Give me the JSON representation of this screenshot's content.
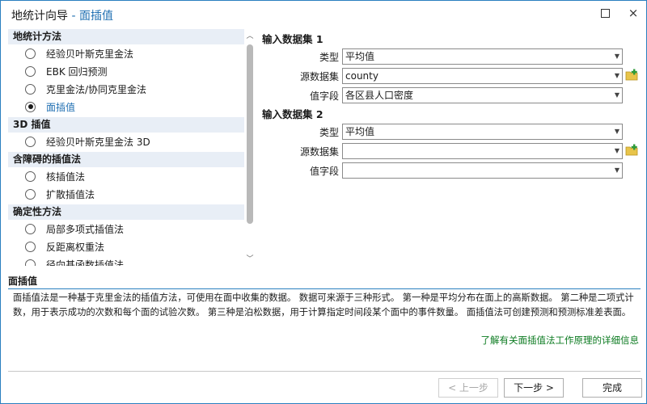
{
  "window": {
    "title_main": "地统计向导",
    "title_sep": " - ",
    "title_sub": "面插值",
    "maximize_icon": "maximize-icon",
    "close_icon": "×"
  },
  "methods": {
    "groups": [
      {
        "header": "地统计方法",
        "options": [
          {
            "label": "经验贝叶斯克里金法",
            "selected": false
          },
          {
            "label": "EBK 回归预测",
            "selected": false
          },
          {
            "label": "克里金法/协同克里金法",
            "selected": false
          },
          {
            "label": "面插值",
            "selected": true
          }
        ]
      },
      {
        "header": "3D 插值",
        "options": [
          {
            "label": "经验贝叶斯克里金法 3D",
            "selected": false
          }
        ]
      },
      {
        "header": "含障碍的插值法",
        "options": [
          {
            "label": "核插值法",
            "selected": false
          },
          {
            "label": "扩散插值法",
            "selected": false
          }
        ]
      },
      {
        "header": "确定性方法",
        "options": [
          {
            "label": "局部多项式插值法",
            "selected": false
          },
          {
            "label": "反距离权重法",
            "selected": false
          },
          {
            "label": "径向基函数插值法",
            "selected": false
          }
        ]
      }
    ]
  },
  "dataset1": {
    "title": "输入数据集 1",
    "type_label": "类型",
    "type_value": "平均值",
    "source_label": "源数据集",
    "source_value": "county",
    "field_label": "值字段",
    "field_value": "各区县人口密度"
  },
  "dataset2": {
    "title": "输入数据集 2",
    "type_label": "类型",
    "type_value": "平均值",
    "source_label": "源数据集",
    "source_value": "",
    "field_label": "值字段",
    "field_value": ""
  },
  "description": {
    "title": "面插值",
    "text": "面插值法是一种基于克里金法的插值方法，可使用在面中收集的数据。 数据可来源于三种形式。 第一种是平均分布在面上的高斯数据。 第二种是二项式计数，用于表示成功的次数和每个面的试验次数。 第三种是泊松数据，用于计算指定时间段某个面中的事件数量。 面插值法可创建预测和预测标准差表面。",
    "link": "了解有关面插值法工作原理的详细信息"
  },
  "buttons": {
    "prev": "< 上一步",
    "next": "下一步 >",
    "finish": "完成"
  },
  "colors": {
    "accent": "#1f6fb2",
    "group_bg": "#e8eef6",
    "link": "#0a7a1f"
  }
}
